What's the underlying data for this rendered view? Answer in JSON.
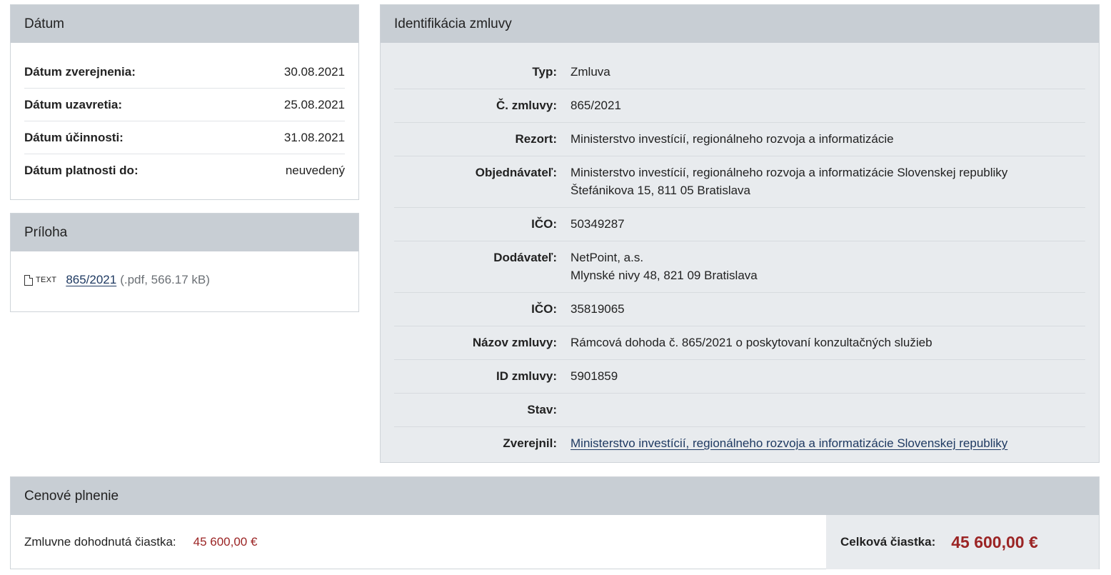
{
  "datum": {
    "title": "Dátum",
    "rows": [
      {
        "label": "Dátum zverejnenia:",
        "value": "30.08.2021"
      },
      {
        "label": "Dátum uzavretia:",
        "value": "25.08.2021"
      },
      {
        "label": "Dátum účinnosti:",
        "value": "31.08.2021"
      },
      {
        "label": "Dátum platnosti do:",
        "value": "neuvedený"
      }
    ]
  },
  "priloha": {
    "title": "Príloha",
    "icon": "pdf-file-icon",
    "type_tag": "TEXT",
    "link_text": "865/2021",
    "meta": "(.pdf, 566.17 kB)"
  },
  "ident": {
    "title": "Identifikácia zmluvy",
    "rows": [
      {
        "label": "Typ:",
        "lines": [
          "Zmluva"
        ]
      },
      {
        "label": "Č. zmluvy:",
        "lines": [
          "865/2021"
        ]
      },
      {
        "label": "Rezort:",
        "lines": [
          "Ministerstvo investícií, regionálneho rozvoja a informatizácie"
        ]
      },
      {
        "label": "Objednávateľ:",
        "lines": [
          "Ministerstvo investícií, regionálneho rozvoja a informatizácie Slovenskej republiky",
          "Štefánikova 15, 811 05 Bratislava"
        ]
      },
      {
        "label": "IČO:",
        "lines": [
          "50349287"
        ]
      },
      {
        "label": "Dodávateľ:",
        "lines": [
          "NetPoint, a.s.",
          "Mlynské nivy 48, 821 09 Bratislava"
        ]
      },
      {
        "label": "IČO:",
        "lines": [
          "35819065"
        ]
      },
      {
        "label": "Názov zmluvy:",
        "lines": [
          "Rámcová dohoda č. 865/2021 o poskytovaní konzultačných služieb"
        ]
      },
      {
        "label": "ID zmluvy:",
        "lines": [
          "5901859"
        ]
      },
      {
        "label": "Stav:",
        "lines": [
          ""
        ]
      },
      {
        "label": "Zverejnil:",
        "link": "Ministerstvo investícií, regionálneho rozvoja a informatizácie Slovenskej republiky"
      }
    ]
  },
  "cena": {
    "title": "Cenové plnenie",
    "agreed_label": "Zmluvne dohodnutá čiastka:",
    "agreed_value": "45 600,00 €",
    "total_label": "Celková čiastka:",
    "total_value": "45 600,00 €"
  },
  "colors": {
    "header_bg": "#c8ced4",
    "panel_bg": "#e8ebee",
    "amount": "#9b2424",
    "link": "#1f3a62"
  }
}
